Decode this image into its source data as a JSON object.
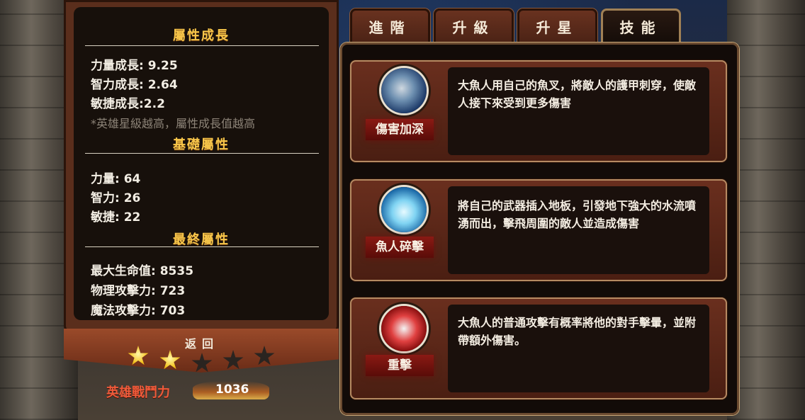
{
  "attributes_growth": {
    "title": "屬性成長",
    "strength": "力量成長: 9.25",
    "intellect": "智力成長: 2.64",
    "agility": "敏捷成長:2.2",
    "note": "*英雄星級越高，屬性成長值越高"
  },
  "base_attributes": {
    "title": "基礎屬性",
    "strength": "力量: 64",
    "intellect": "智力: 26",
    "agility": "敏捷: 22"
  },
  "final_attributes": {
    "title": "最終屬性",
    "max_hp": "最大生命值: 8535",
    "physical_attack": "物理攻擊力: 723",
    "magic_attack": "魔法攻擊力: 703"
  },
  "back_label": "返回",
  "stars": {
    "filled": 2,
    "total": 5
  },
  "combat_power": {
    "label": "英雄戰鬥力",
    "value": "1036"
  },
  "tabs": [
    {
      "label": "進階",
      "active": false
    },
    {
      "label": "升級",
      "active": false
    },
    {
      "label": "升星",
      "active": false
    },
    {
      "label": "技能",
      "active": true
    }
  ],
  "skills": [
    {
      "name": "傷害加深",
      "icon": "trident-icon",
      "description": "大魚人用自己的魚叉，將敵人的護甲刺穿，使敵人接下來受到更多傷害"
    },
    {
      "name": "魚人碎擊",
      "icon": "ice-shatter-icon",
      "description": "將自己的武器插入地板，引發地下強大的水流噴湧而出，擊飛周圍的敵人並造成傷害"
    },
    {
      "name": "重擊",
      "icon": "heavy-strike-icon",
      "description": "大魚人的普通攻擊有概率將他的對手擊暈，並附帶額外傷害。"
    }
  ],
  "colors": {
    "gold_title": "#f7c64a",
    "panel_brown": "#5a2e1c",
    "skill_name_red": "#8a1a14",
    "power_red": "#ef5a3a"
  }
}
